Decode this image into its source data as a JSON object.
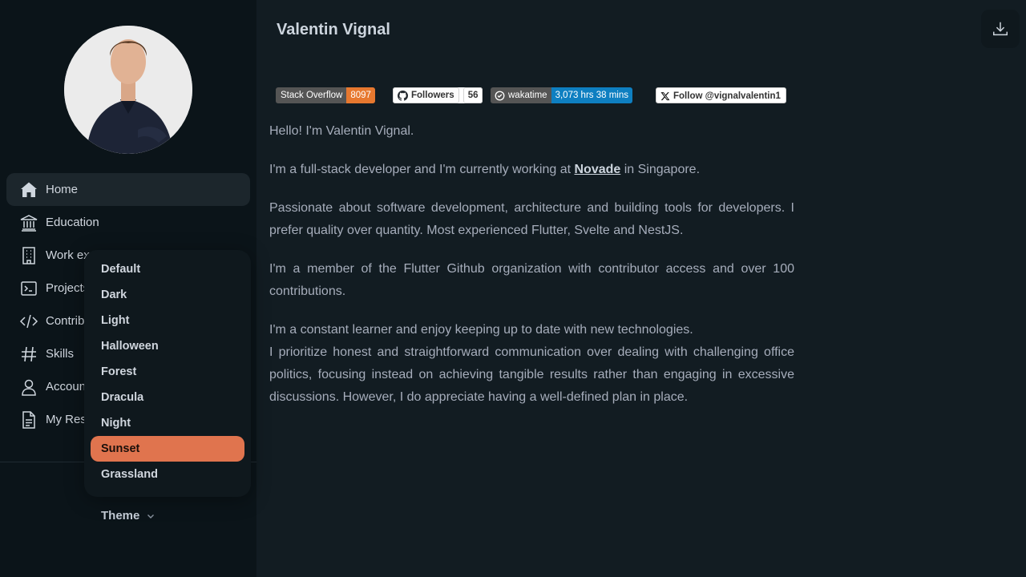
{
  "header": {
    "title": "Valentin Vignal"
  },
  "sidebar": {
    "items": [
      {
        "label": "Home",
        "icon": "home-icon",
        "active": true
      },
      {
        "label": "Education",
        "icon": "bank-icon"
      },
      {
        "label": "Work ex",
        "icon": "building-icon"
      },
      {
        "label": "Projects",
        "icon": "terminal-icon"
      },
      {
        "label": "Contrib",
        "icon": "code-icon"
      },
      {
        "label": "Skills",
        "icon": "hash-icon"
      },
      {
        "label": "Accoun",
        "icon": "user-icon"
      },
      {
        "label": "My Res",
        "icon": "document-icon"
      }
    ],
    "theme_label": "Theme"
  },
  "theme_menu": {
    "options": [
      "Default",
      "Dark",
      "Light",
      "Halloween",
      "Forest",
      "Dracula",
      "Night",
      "Sunset",
      "Grassland"
    ],
    "selected": "Sunset"
  },
  "badges": {
    "stackoverflow": {
      "label": "Stack Overflow",
      "value": "8097"
    },
    "github": {
      "label": "Followers",
      "value": "56"
    },
    "wakatime": {
      "label": "wakatime",
      "value": "3,073 hrs 38 mins"
    },
    "twitter": {
      "label": "Follow @vignalvalentin1"
    }
  },
  "content": {
    "p1": "Hello! I'm Valentin Vignal.",
    "p2_before": "I'm a full-stack developer and I'm currently working at ",
    "p2_link": "Novade",
    "p2_after": " in Singapore.",
    "p3": "Passionate about software development, architecture and building tools for developers. I prefer quality over quantity. Most experienced Flutter, Svelte and NestJS.",
    "p4": "I'm a member of the Flutter Github organization with contributor access and over 100 contributions.",
    "p5a": "I'm a constant learner and enjoy keeping up to date with new technologies.",
    "p5b": "I prioritize honest and straightforward communication over dealing with challenging office politics, focusing instead on achieving tangible results rather than engaging in excessive discussions. However, I do appreciate having a well-defined plan in place."
  },
  "colors": {
    "background": "#121c22",
    "sidebar": "#0b1419",
    "accent": "#e0744e",
    "stackoverflow_value": "#e7782f",
    "wakatime_value": "#0e7fc1"
  }
}
